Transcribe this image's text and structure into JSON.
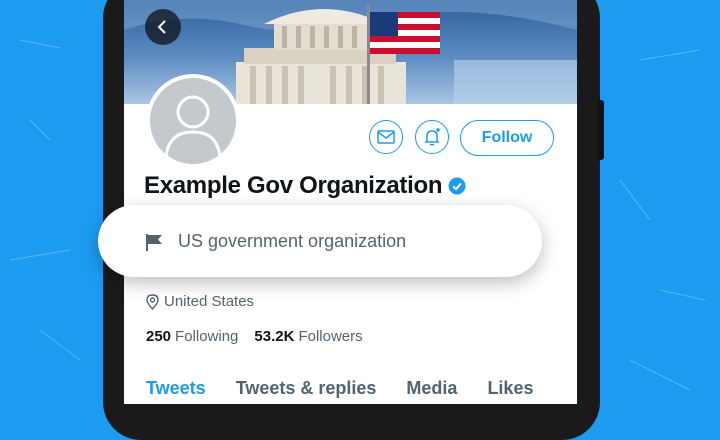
{
  "profile": {
    "name": "Example Gov Organization",
    "label": "US government organization",
    "location": "United States",
    "following_count": "250",
    "following_label": "Following",
    "followers_count": "53.2K",
    "followers_label": "Followers",
    "follow_label": "Follow"
  },
  "tabs": [
    {
      "label": "Tweets",
      "active": true
    },
    {
      "label": "Tweets & replies",
      "active": false
    },
    {
      "label": "Media",
      "active": false
    },
    {
      "label": "Likes",
      "active": false
    }
  ],
  "icons": {
    "back": "chevron-left-icon",
    "message": "mail-icon",
    "notify": "bell-plus-icon",
    "verified": "verified-badge-icon",
    "label": "flag-icon",
    "location": "location-pin-icon"
  },
  "colors": {
    "accent": "#1d9bf0",
    "text_primary": "#0f1419",
    "text_secondary": "#536471",
    "background": "#1d9bf0"
  }
}
